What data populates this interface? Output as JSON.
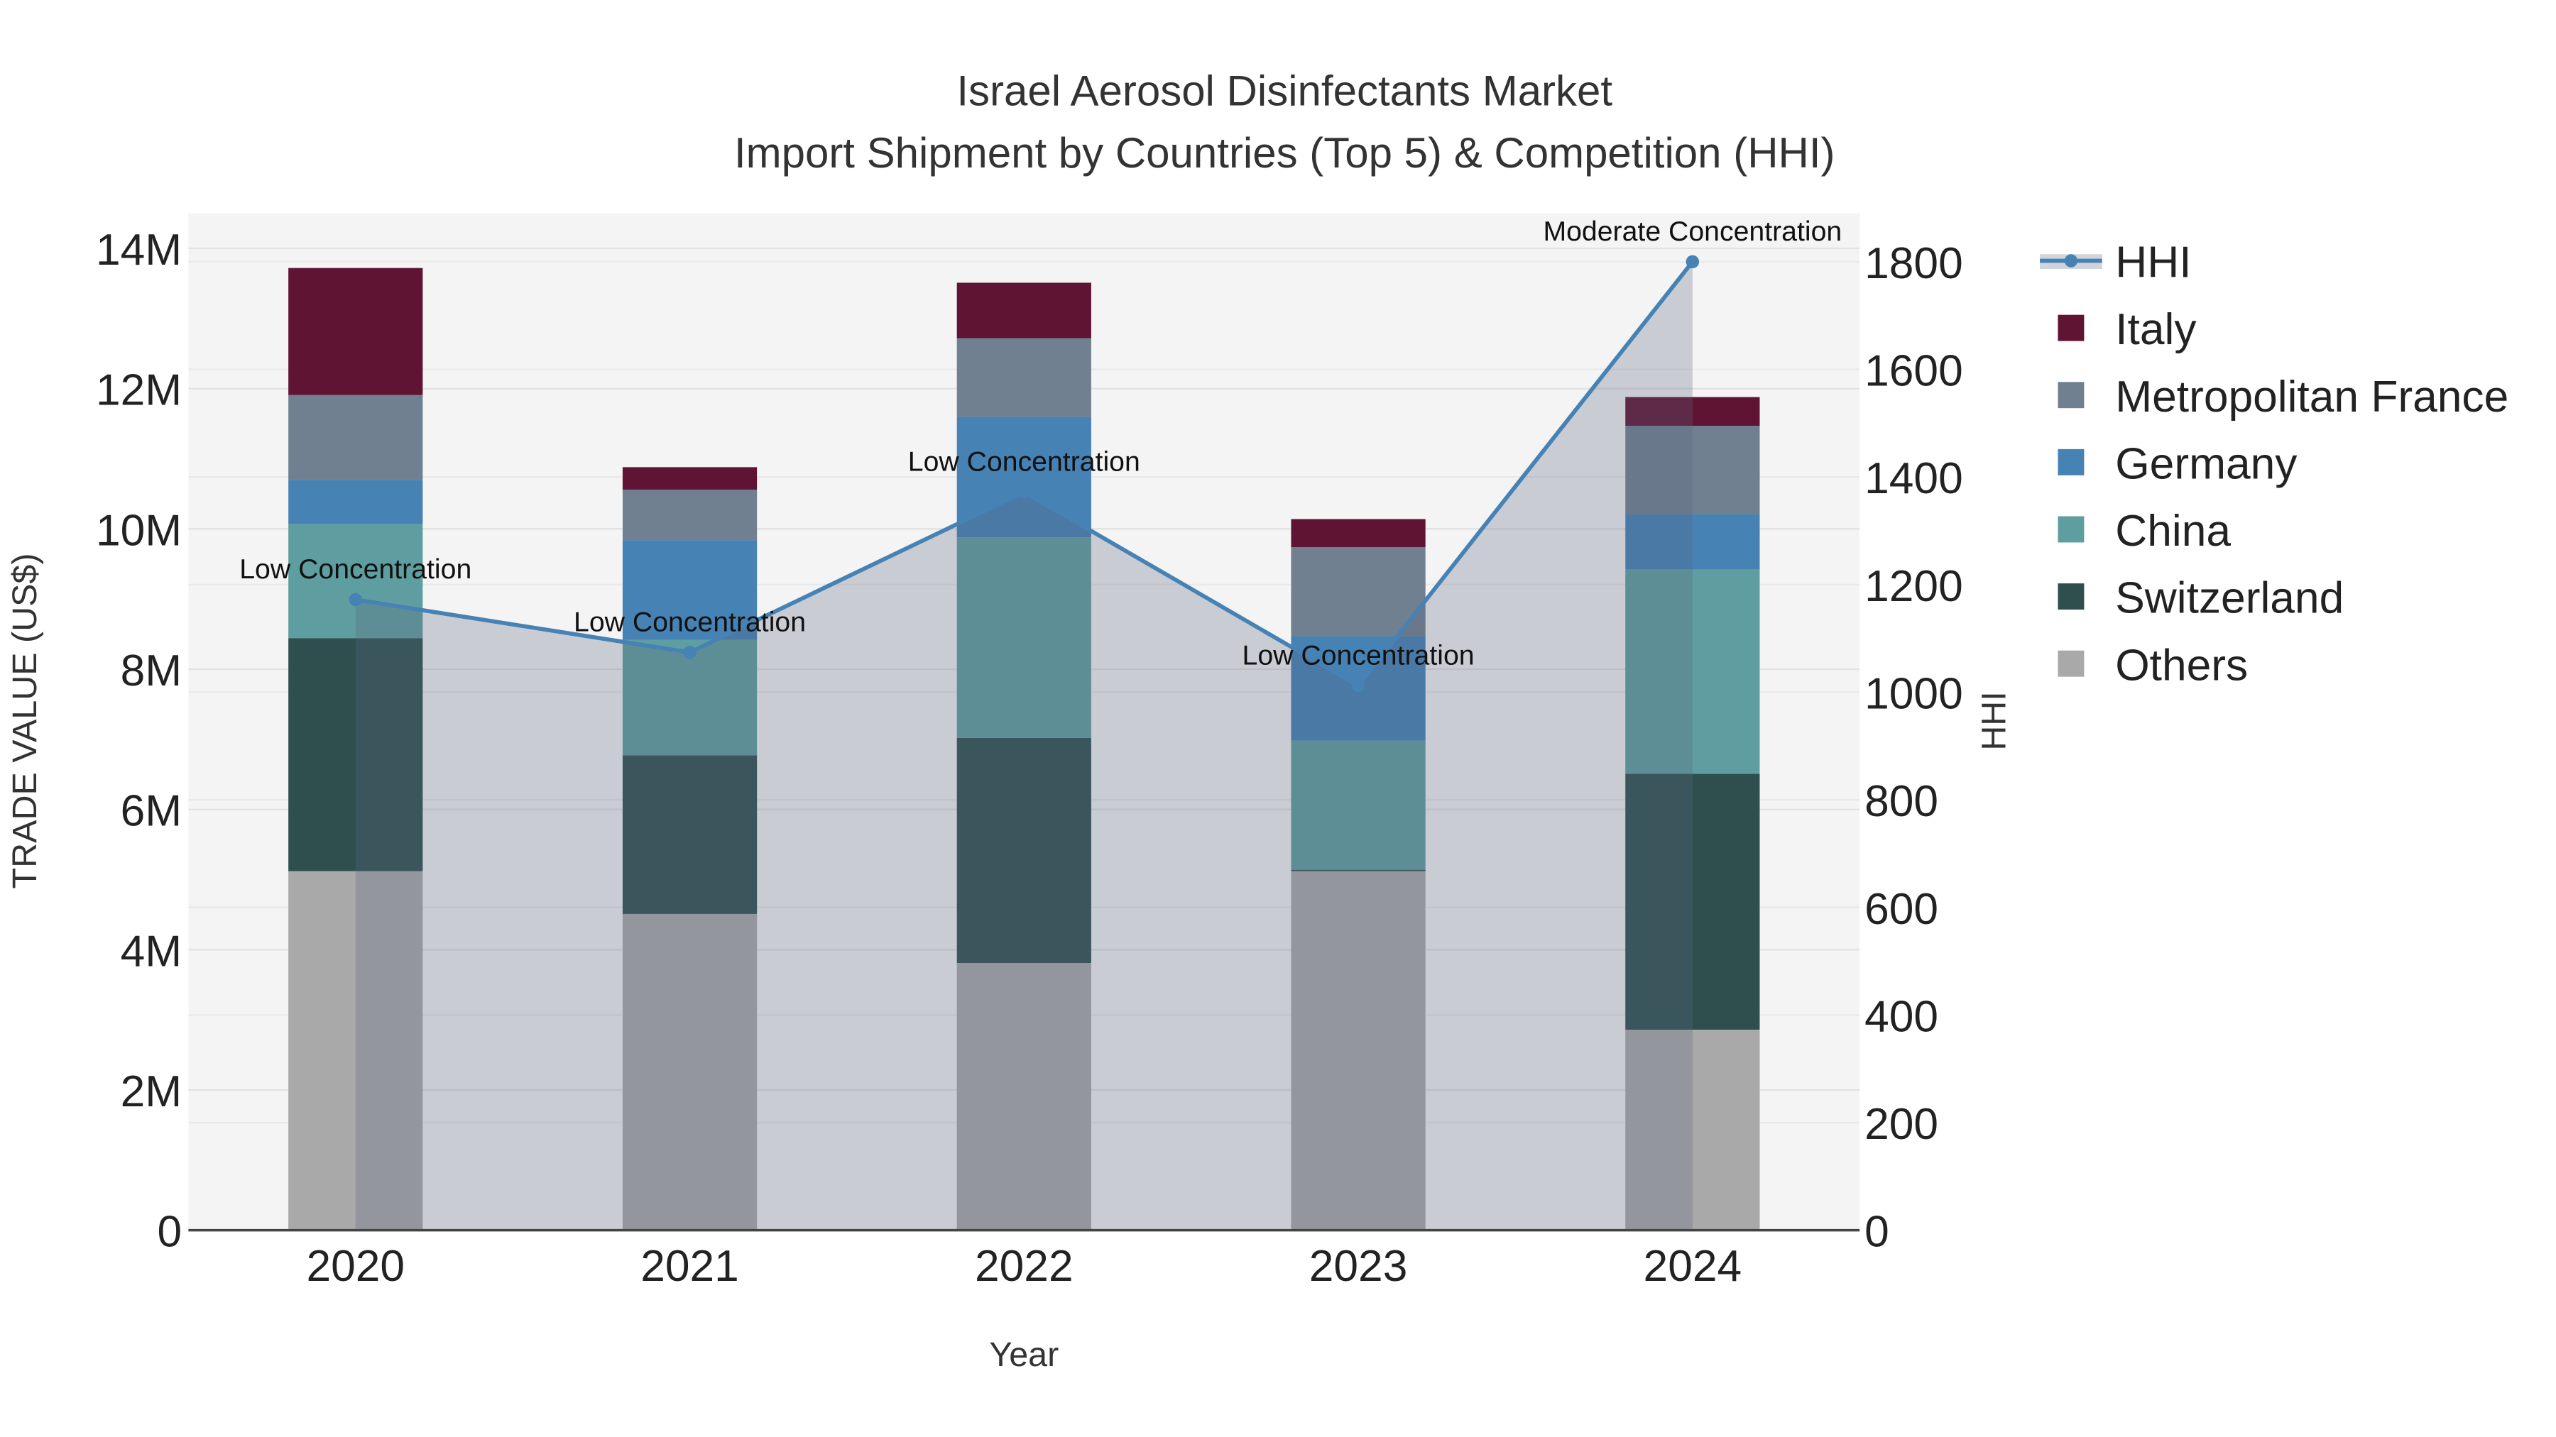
{
  "chart_data": {
    "type": "bar",
    "stacked": true,
    "title": "Israel Aerosol Disinfectants Market",
    "subtitle": "Import Shipment by Countries (Top 5) & Competition (HHI)",
    "xlabel": "Year",
    "ylabel": "TRADE VALUE (US$)",
    "y2label": "HHI",
    "categories": [
      "2020",
      "2021",
      "2022",
      "2023",
      "2024"
    ],
    "ylim": [
      0,
      14500000
    ],
    "y2lim": [
      0,
      1890
    ],
    "yticks": [
      0,
      2000000,
      4000000,
      6000000,
      8000000,
      10000000,
      12000000,
      14000000
    ],
    "ytick_labels": [
      "0",
      "2M",
      "4M",
      "6M",
      "8M",
      "10M",
      "12M",
      "14M"
    ],
    "y2ticks": [
      0,
      200,
      400,
      600,
      800,
      1000,
      1200,
      1400,
      1600,
      1800
    ],
    "y2tick_labels": [
      "0",
      "200",
      "400",
      "600",
      "800",
      "1000",
      "1200",
      "1400",
      "1600",
      "1800"
    ],
    "grid": true,
    "legend_position": "right",
    "series": [
      {
        "name": "Others",
        "color": "#a9a9a9",
        "values": [
          5120000,
          4510000,
          3810000,
          5120000,
          2860000
        ]
      },
      {
        "name": "Switzerland",
        "color": "#2f4f4f",
        "values": [
          3320000,
          2260000,
          3210000,
          20000,
          3650000
        ]
      },
      {
        "name": "China",
        "color": "#5f9ea0",
        "values": [
          1630000,
          1650000,
          2860000,
          1840000,
          2910000
        ]
      },
      {
        "name": "Germany",
        "color": "#4682b4",
        "values": [
          630000,
          1420000,
          1720000,
          1490000,
          790000
        ]
      },
      {
        "name": "Metropolitan France",
        "color": "#708090",
        "values": [
          1210000,
          720000,
          1120000,
          1270000,
          1260000
        ]
      },
      {
        "name": "Italy",
        "color": "#5f1434",
        "values": [
          1810000,
          320000,
          790000,
          400000,
          410000
        ]
      }
    ],
    "line": {
      "name": "HHI",
      "color": "#4682b4",
      "values": [
        1172,
        1074,
        1372,
        1012,
        1800
      ],
      "annotations": [
        "Low Concentration",
        "Low Concentration",
        "Low Concentration",
        "Low Concentration",
        "Moderate Concentration"
      ]
    }
  }
}
